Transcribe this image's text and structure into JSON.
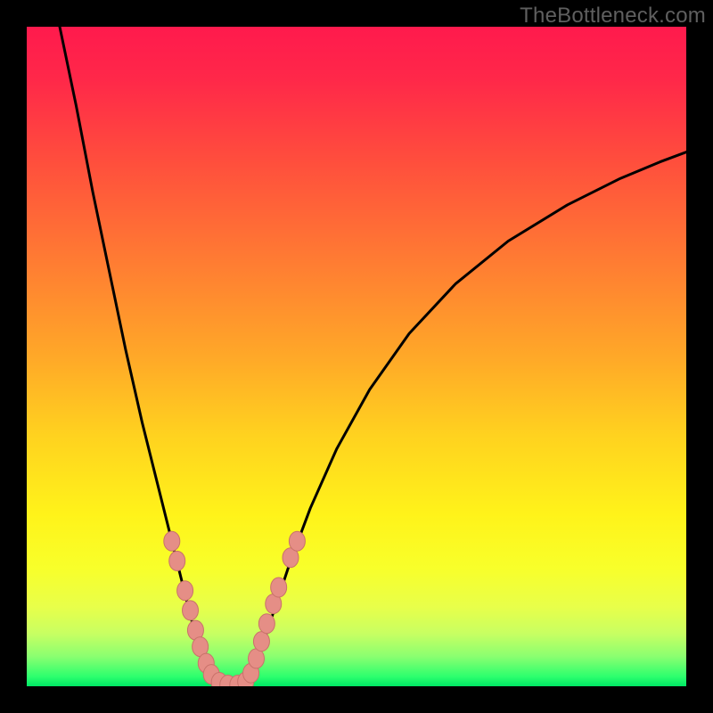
{
  "watermark": "TheBottleneck.com",
  "colors": {
    "frame": "#000000",
    "gradient_stops": [
      {
        "offset": 0.0,
        "color": "#ff1a4d"
      },
      {
        "offset": 0.08,
        "color": "#ff2849"
      },
      {
        "offset": 0.2,
        "color": "#ff4d3d"
      },
      {
        "offset": 0.35,
        "color": "#ff7a33"
      },
      {
        "offset": 0.5,
        "color": "#ffa828"
      },
      {
        "offset": 0.62,
        "color": "#ffd21f"
      },
      {
        "offset": 0.74,
        "color": "#fff31a"
      },
      {
        "offset": 0.82,
        "color": "#f8ff2a"
      },
      {
        "offset": 0.88,
        "color": "#e8ff4a"
      },
      {
        "offset": 0.92,
        "color": "#c8ff62"
      },
      {
        "offset": 0.955,
        "color": "#8aff70"
      },
      {
        "offset": 0.985,
        "color": "#2eff6e"
      },
      {
        "offset": 1.0,
        "color": "#00e865"
      }
    ],
    "curve": "#000000",
    "marker_fill": "#e58e86",
    "marker_stroke": "#c9726a"
  },
  "chart_data": {
    "type": "line",
    "title": "",
    "xlabel": "",
    "ylabel": "",
    "xlim": [
      0,
      100
    ],
    "ylim": [
      0,
      100
    ],
    "note": "x is a normalized component-ratio axis (0–100); y is bottleneck percentage (0 = perfect match, 100 = full bottleneck). Values estimated from pixel positions — no tick labels visible.",
    "series": [
      {
        "name": "left-branch",
        "x": [
          5,
          7.5,
          10,
          12.5,
          15,
          17.5,
          20,
          21,
          22,
          23,
          24,
          25,
          26,
          27,
          28,
          29
        ],
        "y": [
          100,
          88,
          75,
          63,
          51,
          40,
          30,
          26,
          22,
          18,
          14,
          10,
          6.5,
          3.5,
          1.5,
          0.5
        ]
      },
      {
        "name": "valley",
        "x": [
          29,
          30,
          31,
          32,
          33
        ],
        "y": [
          0.5,
          0,
          0,
          0,
          0.5
        ]
      },
      {
        "name": "right-branch",
        "x": [
          33,
          34,
          35,
          36,
          38,
          40,
          43,
          47,
          52,
          58,
          65,
          73,
          82,
          90,
          96,
          100
        ],
        "y": [
          0.5,
          2,
          4,
          7,
          13,
          19,
          27,
          36,
          45,
          53.5,
          61,
          67.5,
          73,
          77,
          79.5,
          81
        ]
      }
    ],
    "markers": {
      "name": "benchmark-samples",
      "note": "pink beads along both branches near the valley; positions estimated",
      "points": [
        {
          "x": 22.0,
          "y": 22.0
        },
        {
          "x": 22.8,
          "y": 19.0
        },
        {
          "x": 24.0,
          "y": 14.5
        },
        {
          "x": 24.8,
          "y": 11.5
        },
        {
          "x": 25.6,
          "y": 8.5
        },
        {
          "x": 26.3,
          "y": 6.0
        },
        {
          "x": 27.2,
          "y": 3.5
        },
        {
          "x": 28.0,
          "y": 1.8
        },
        {
          "x": 29.2,
          "y": 0.6
        },
        {
          "x": 30.5,
          "y": 0.2
        },
        {
          "x": 32.0,
          "y": 0.2
        },
        {
          "x": 33.2,
          "y": 0.7
        },
        {
          "x": 34.0,
          "y": 2.0
        },
        {
          "x": 34.8,
          "y": 4.2
        },
        {
          "x": 35.6,
          "y": 6.8
        },
        {
          "x": 36.4,
          "y": 9.5
        },
        {
          "x": 37.4,
          "y": 12.5
        },
        {
          "x": 38.2,
          "y": 15.0
        },
        {
          "x": 40.0,
          "y": 19.5
        },
        {
          "x": 41.0,
          "y": 22.0
        }
      ]
    }
  }
}
